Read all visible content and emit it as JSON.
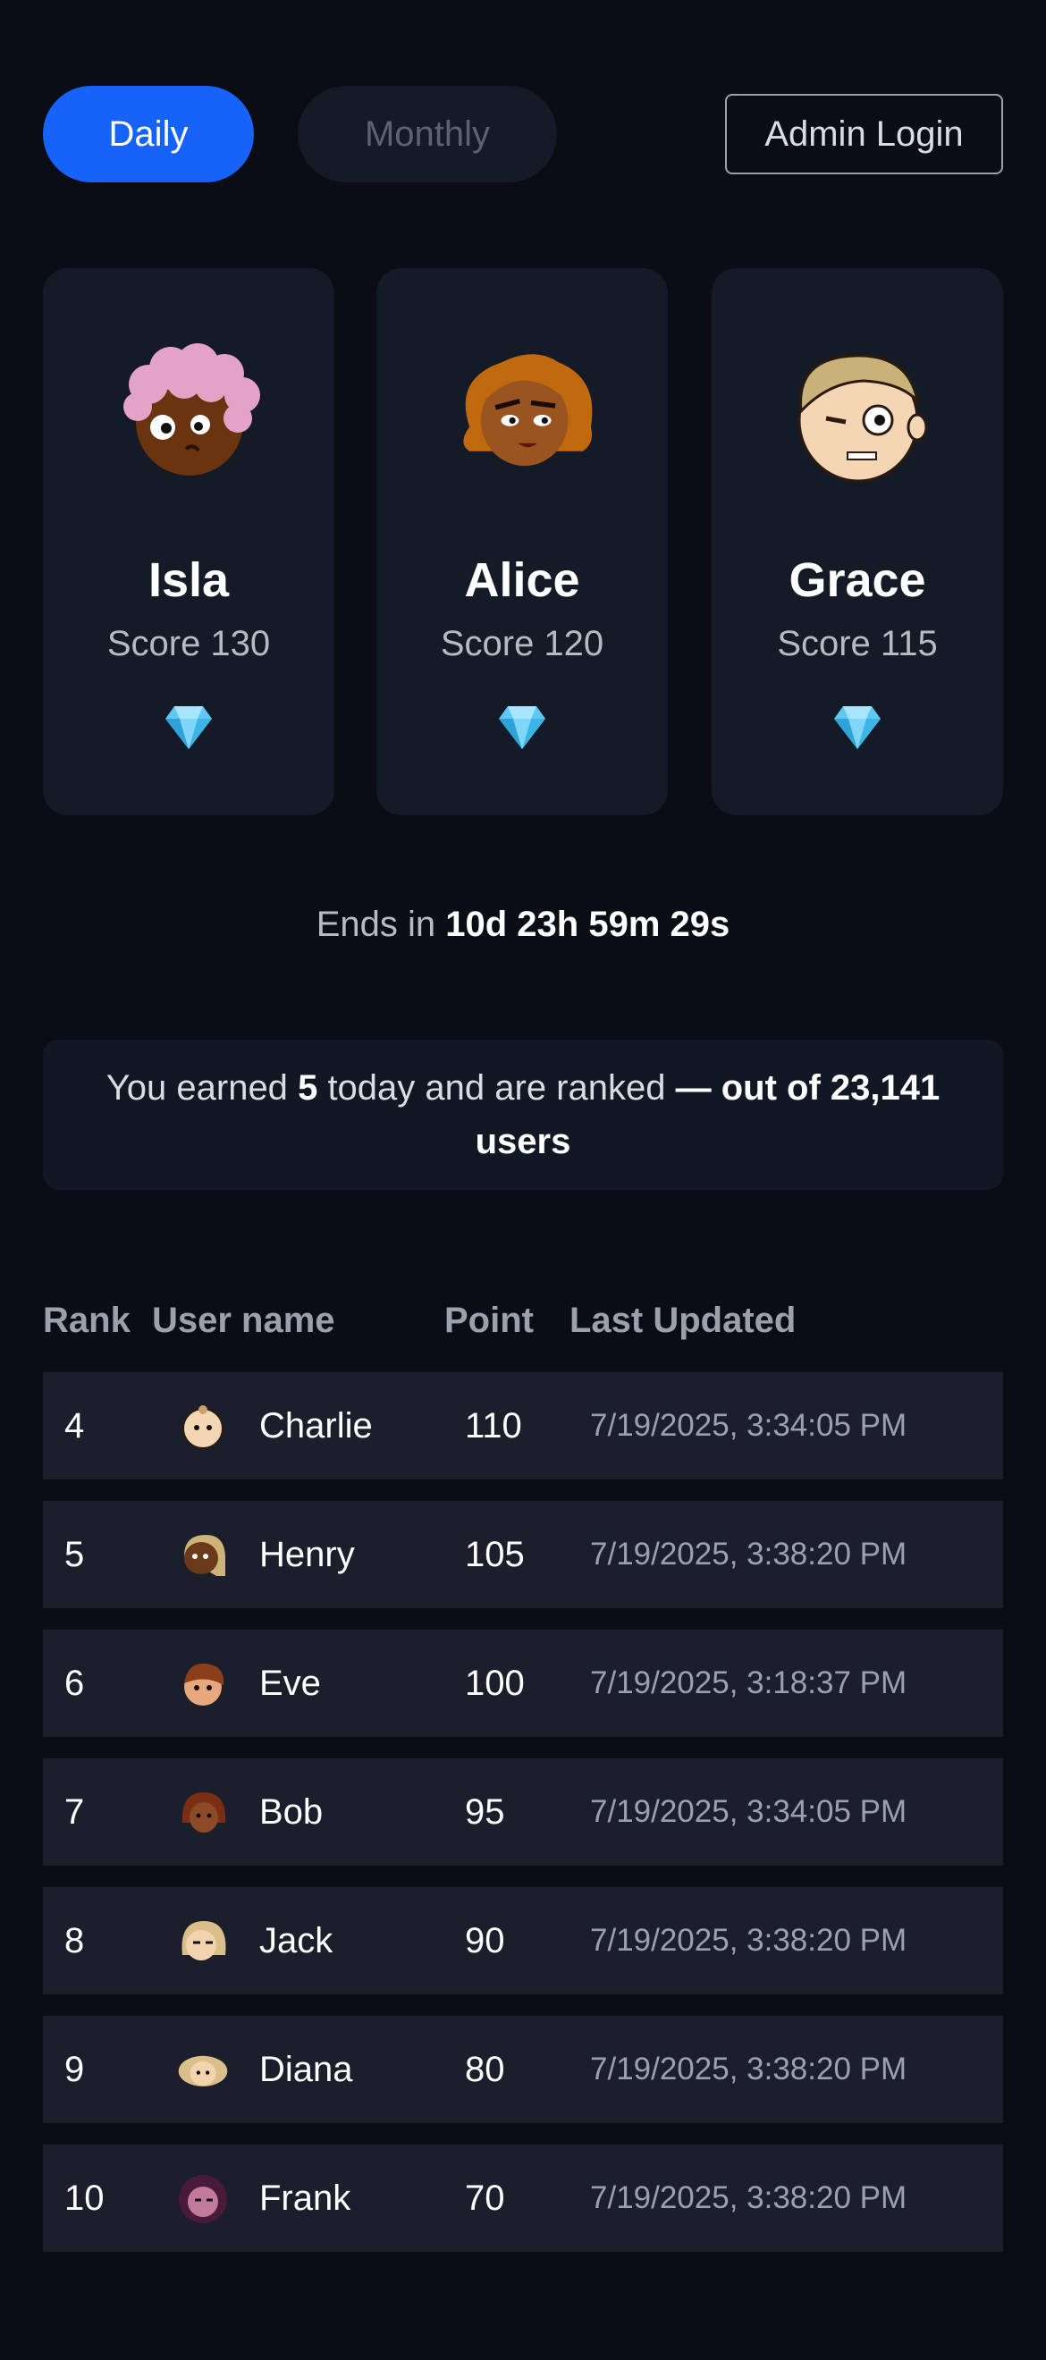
{
  "tabs": {
    "daily": "Daily",
    "monthly": "Monthly"
  },
  "admin_login": "Admin Login",
  "podium": [
    {
      "name": "Isla",
      "score": "Score 130",
      "avatar": "cartoon-avatar-pink-hair"
    },
    {
      "name": "Alice",
      "score": "Score 120",
      "avatar": "cartoon-avatar-orange-hair"
    },
    {
      "name": "Grace",
      "score": "Score 115",
      "avatar": "cartoon-avatar-blond-hair"
    }
  ],
  "gem_icon": "diamond-icon",
  "countdown": {
    "prefix": "Ends in",
    "value": "10d 23h 59m 29s"
  },
  "earned": {
    "part1": "You earned",
    "amount": "5",
    "part2": "today and are ranked",
    "part3": "— out of 23,141 users"
  },
  "table": {
    "headers": {
      "rank": "Rank",
      "user": "User name",
      "point": "Point",
      "updated": "Last Updated"
    },
    "rows": [
      {
        "rank": "4",
        "name": "Charlie",
        "point": "110",
        "updated": "7/19/2025, 3:34:05 PM"
      },
      {
        "rank": "5",
        "name": "Henry",
        "point": "105",
        "updated": "7/19/2025, 3:38:20 PM"
      },
      {
        "rank": "6",
        "name": "Eve",
        "point": "100",
        "updated": "7/19/2025, 3:18:37 PM"
      },
      {
        "rank": "7",
        "name": "Bob",
        "point": "95",
        "updated": "7/19/2025, 3:34:05 PM"
      },
      {
        "rank": "8",
        "name": "Jack",
        "point": "90",
        "updated": "7/19/2025, 3:38:20 PM"
      },
      {
        "rank": "9",
        "name": "Diana",
        "point": "80",
        "updated": "7/19/2025, 3:38:20 PM"
      },
      {
        "rank": "10",
        "name": "Frank",
        "point": "70",
        "updated": "7/19/2025, 3:38:20 PM"
      }
    ]
  },
  "colors": {
    "background": "#0b0d16",
    "accent": "#1762f8",
    "card": "#141a26",
    "row": "#1b1f2b"
  }
}
